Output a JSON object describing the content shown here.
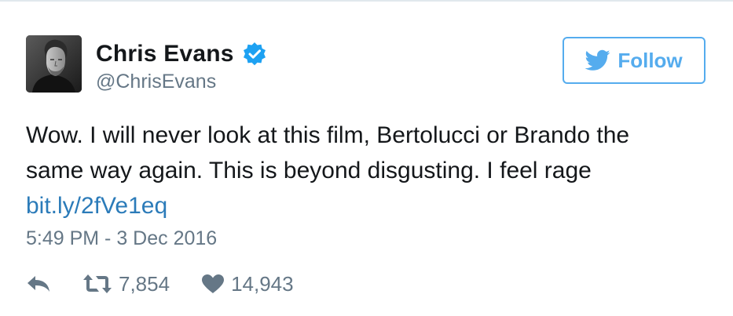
{
  "user": {
    "display_name": "Chris Evans",
    "handle": "@ChrisEvans",
    "verified": true,
    "avatar_icon": "profile-photo"
  },
  "follow_button": {
    "label": "Follow",
    "icon": "twitter-bird-icon",
    "color": "#55acee"
  },
  "tweet": {
    "text_line1": "Wow. I will never look at this film, Bertolucci or Brando the",
    "text_line2": "same way again. This is beyond disgusting. I feel rage",
    "link": "bit.ly/2fVe1eq",
    "timestamp": "5:49 PM - 3 Dec 2016"
  },
  "actions": {
    "reply_icon": "reply-icon",
    "retweet_icon": "retweet-icon",
    "retweet_count": "7,854",
    "like_icon": "heart-icon",
    "like_count": "14,943"
  },
  "colors": {
    "text": "#14171a",
    "secondary": "#657786",
    "link": "#2b7bb9",
    "brand": "#55acee",
    "verified": "#1da1f2"
  }
}
